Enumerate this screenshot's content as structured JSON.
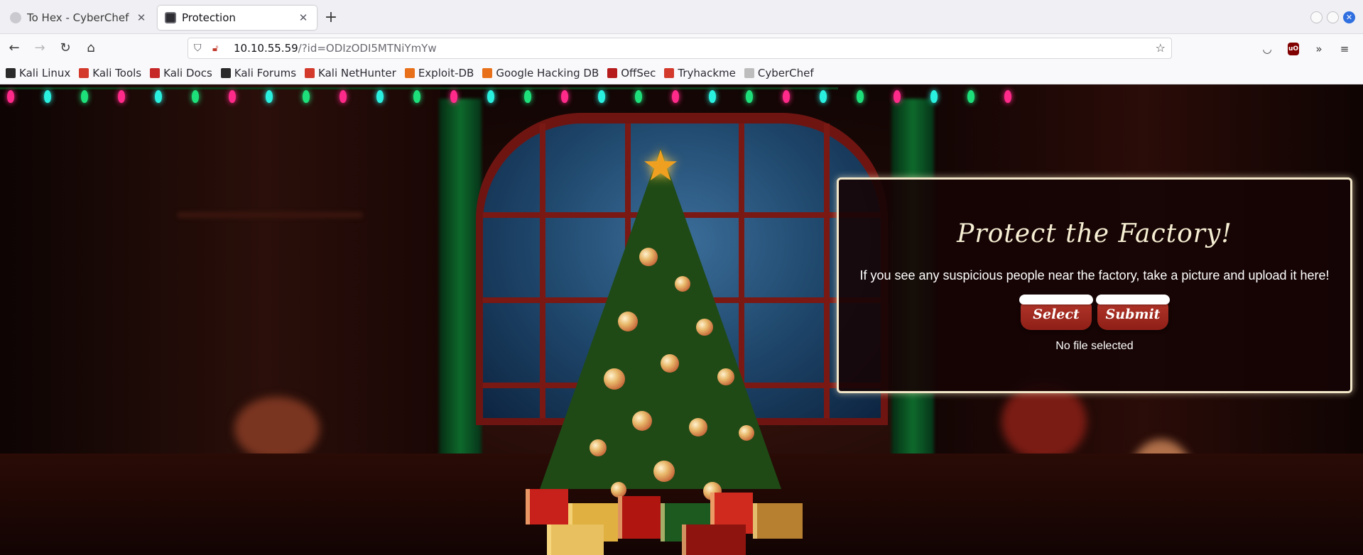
{
  "browser": {
    "tabs": [
      {
        "label": "To Hex - CyberChef",
        "active": false
      },
      {
        "label": "Protection",
        "active": true
      }
    ],
    "url": {
      "host": "10.10.55.59",
      "path": "/?id=ODIzODI5MTNiYmYw"
    },
    "bookmarks": [
      {
        "label": "Kali Linux",
        "icon_color": "#2a2a2a"
      },
      {
        "label": "Kali Tools",
        "icon_color": "#d33a2c"
      },
      {
        "label": "Kali Docs",
        "icon_color": "#c62828"
      },
      {
        "label": "Kali Forums",
        "icon_color": "#2a2a2a"
      },
      {
        "label": "Kali NetHunter",
        "icon_color": "#d33a2c"
      },
      {
        "label": "Exploit-DB",
        "icon_color": "#e8701a"
      },
      {
        "label": "Google Hacking DB",
        "icon_color": "#e8701a"
      },
      {
        "label": "OffSec",
        "icon_color": "#b71c1c"
      },
      {
        "label": "Tryhackme",
        "icon_color": "#d33a2c"
      },
      {
        "label": "CyberChef",
        "icon_color": "#bdbdbd"
      }
    ]
  },
  "panel": {
    "title": "Protect the Factory!",
    "description": "If you see any suspicious people near the factory, take a picture and upload it here!",
    "select_label": "Select",
    "submit_label": "Submit",
    "file_status": "No file selected"
  },
  "colors": {
    "panel_border": "#f2e6c8",
    "button_red": "#a52a22",
    "light_colors": [
      "#ff2a8a",
      "#2af0e0",
      "#1ee07a"
    ]
  },
  "icons": {
    "back": "arrow-left-icon",
    "forward": "arrow-right-icon",
    "reload": "reload-icon",
    "home": "home-icon",
    "shield": "shield-icon",
    "lock": "insecure-lock-icon",
    "bookmark_star": "star-icon",
    "pocket": "pocket-icon",
    "ublock": "ublock-icon",
    "overflow": "chevron-double-right-icon",
    "menu": "hamburger-menu-icon"
  }
}
